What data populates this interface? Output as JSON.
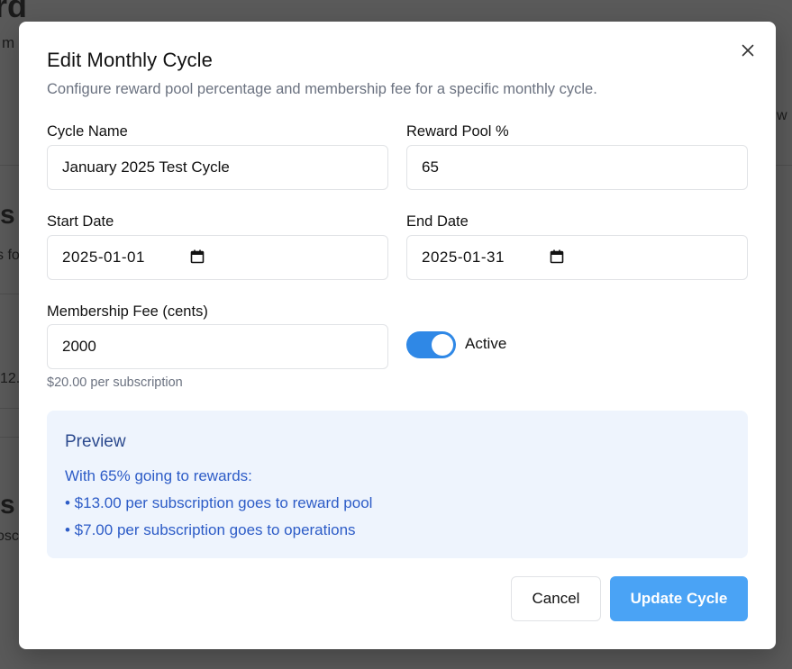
{
  "background": {
    "frag_title": "rd",
    "frag_sub": "m",
    "frag_right": "w",
    "frag_s1": "s",
    "frag_f": "s fo",
    "frag_num": "12.",
    "frag_s2": "s",
    "frag_bsc": "osc"
  },
  "modal": {
    "title": "Edit Monthly Cycle",
    "description": "Configure reward pool percentage and membership fee for a specific monthly cycle.",
    "close_icon": "close-icon"
  },
  "form": {
    "cycle_name": {
      "label": "Cycle Name",
      "value": "January 2025 Test Cycle"
    },
    "reward_pool": {
      "label": "Reward Pool %",
      "value": "65"
    },
    "start_date": {
      "label": "Start Date",
      "value": "2025-01-01",
      "icon": "calendar-icon"
    },
    "end_date": {
      "label": "End Date",
      "value": "2025-01-31",
      "icon": "calendar-icon"
    },
    "membership_fee": {
      "label": "Membership Fee (cents)",
      "value": "2000",
      "hint": "$20.00 per subscription"
    },
    "active": {
      "label": "Active",
      "on": true,
      "color": "#2f88e6"
    }
  },
  "preview": {
    "title": "Preview",
    "intro": "With 65% going to rewards:",
    "reward_line": "• $13.00 per subscription goes to reward pool",
    "ops_line": "• $7.00 per subscription goes to operations"
  },
  "buttons": {
    "cancel": "Cancel",
    "update": "Update Cycle",
    "primary_color": "#4aa3f5"
  }
}
